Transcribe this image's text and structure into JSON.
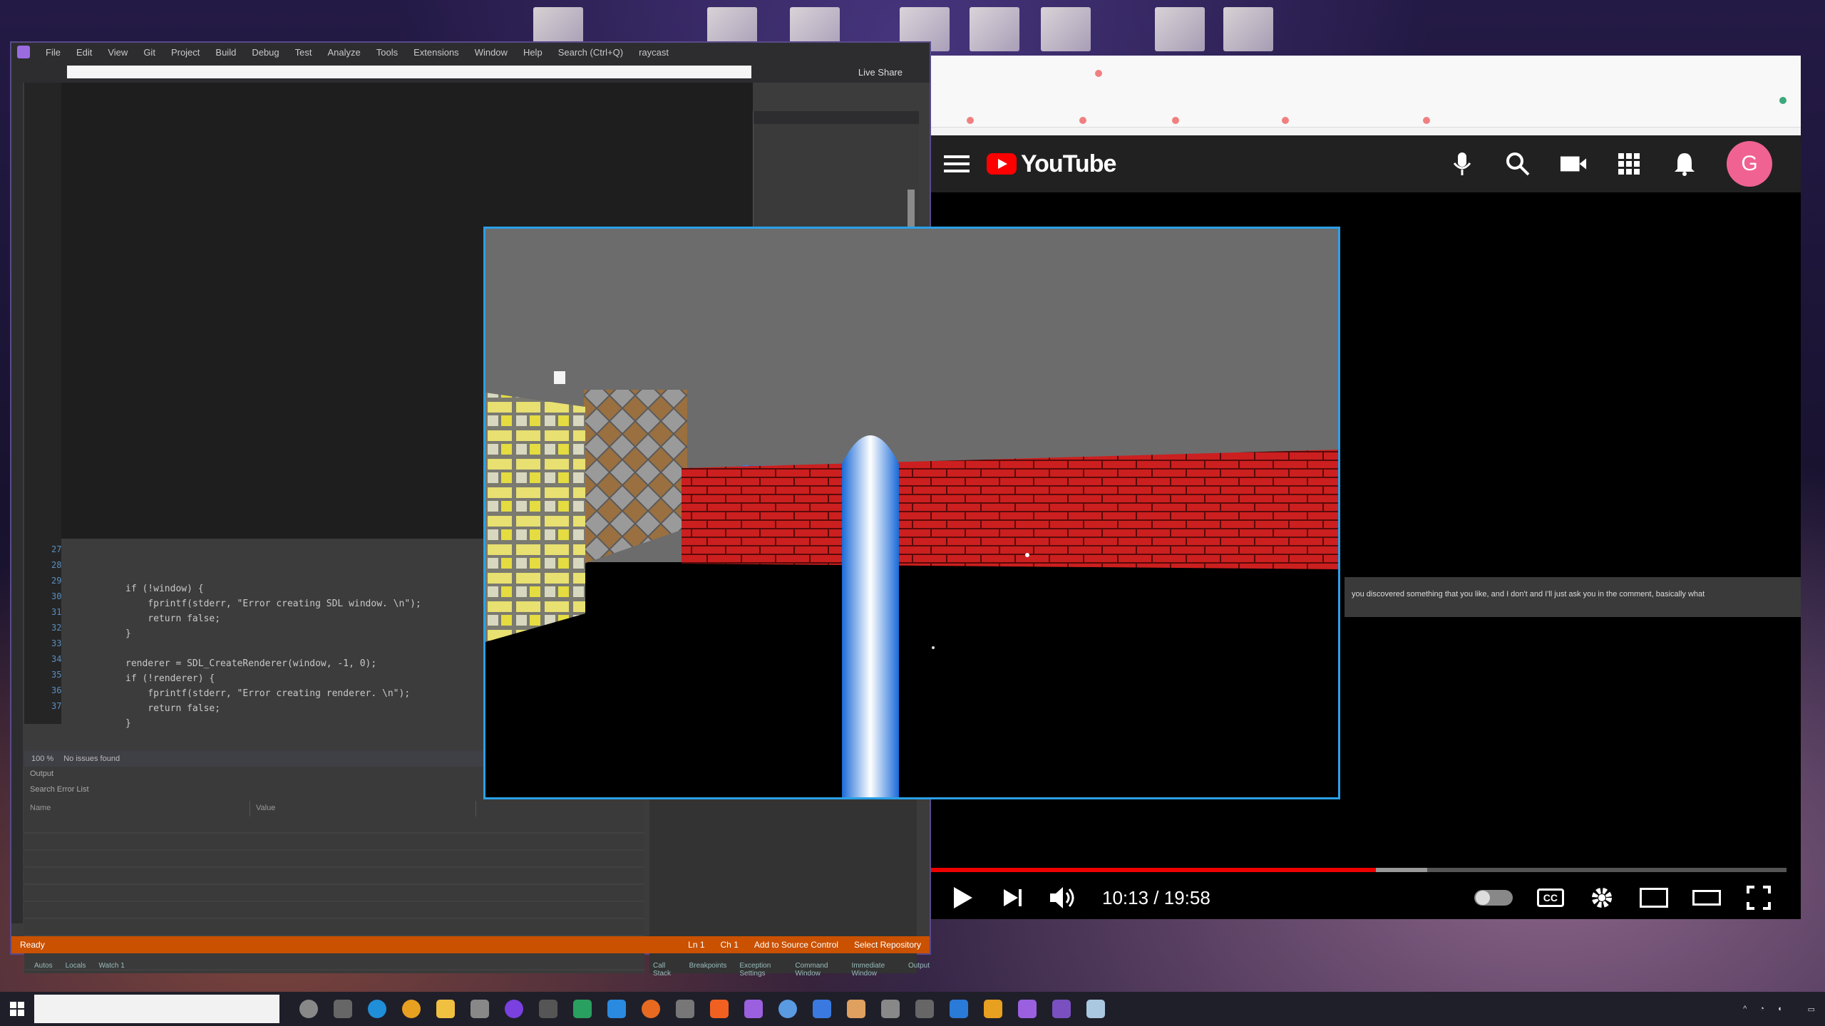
{
  "vs": {
    "menu": [
      "File",
      "Edit",
      "View",
      "Git",
      "Project",
      "Build",
      "Debug",
      "Test",
      "Analyze",
      "Tools",
      "Extensions",
      "Window",
      "Help",
      "Search (Ctrl+Q)",
      "raycast"
    ],
    "live_share": "Live Share",
    "line_numbers": [
      "27",
      "28",
      "29",
      "30",
      "31",
      "32",
      "33",
      "34",
      "35",
      "36",
      "37"
    ],
    "code_lines": [
      "if (!window) {",
      "    fprintf(stderr, \"Error creating SDL window. \\n\");",
      "    return false;",
      "}",
      "",
      "renderer = SDL_CreateRenderer(window, -1, 0);",
      "if (!renderer) {",
      "    fprintf(stderr, \"Error creating renderer. \\n\");",
      "    return false;",
      "}"
    ],
    "status_tabs": [
      "100 %",
      "No issues found"
    ],
    "bottom_header": "Output",
    "bottom_source": "Search Error List",
    "bottom_cols": [
      "Name",
      "Value"
    ],
    "bottom_tabs": [
      "Autos",
      "Locals",
      "Watch 1"
    ],
    "bottom_tabs_right": [
      "Call Stack",
      "Breakpoints",
      "Exception Settings",
      "Command Window",
      "Immediate Window",
      "Output"
    ],
    "status_ready": "Ready",
    "status_right": [
      "Ln 1",
      "Ch 1",
      "Add to Source Control",
      "Select Repository"
    ]
  },
  "youtube": {
    "logo_text": "YouTube",
    "avatar_letter": "G",
    "description": "you discovered something that you like, and I don't and I'll just ask you in the comment, basically what",
    "time": "10:13 / 19:58",
    "progress": 0.52,
    "buffered": 0.58,
    "cc_label": "CC"
  },
  "taskbar": {
    "search_placeholder": ""
  },
  "colors": {
    "vs_accent": "#ca5100",
    "game_border": "#2aa0e8",
    "yt_red": "#ff0000",
    "avatar": "#f06292"
  }
}
